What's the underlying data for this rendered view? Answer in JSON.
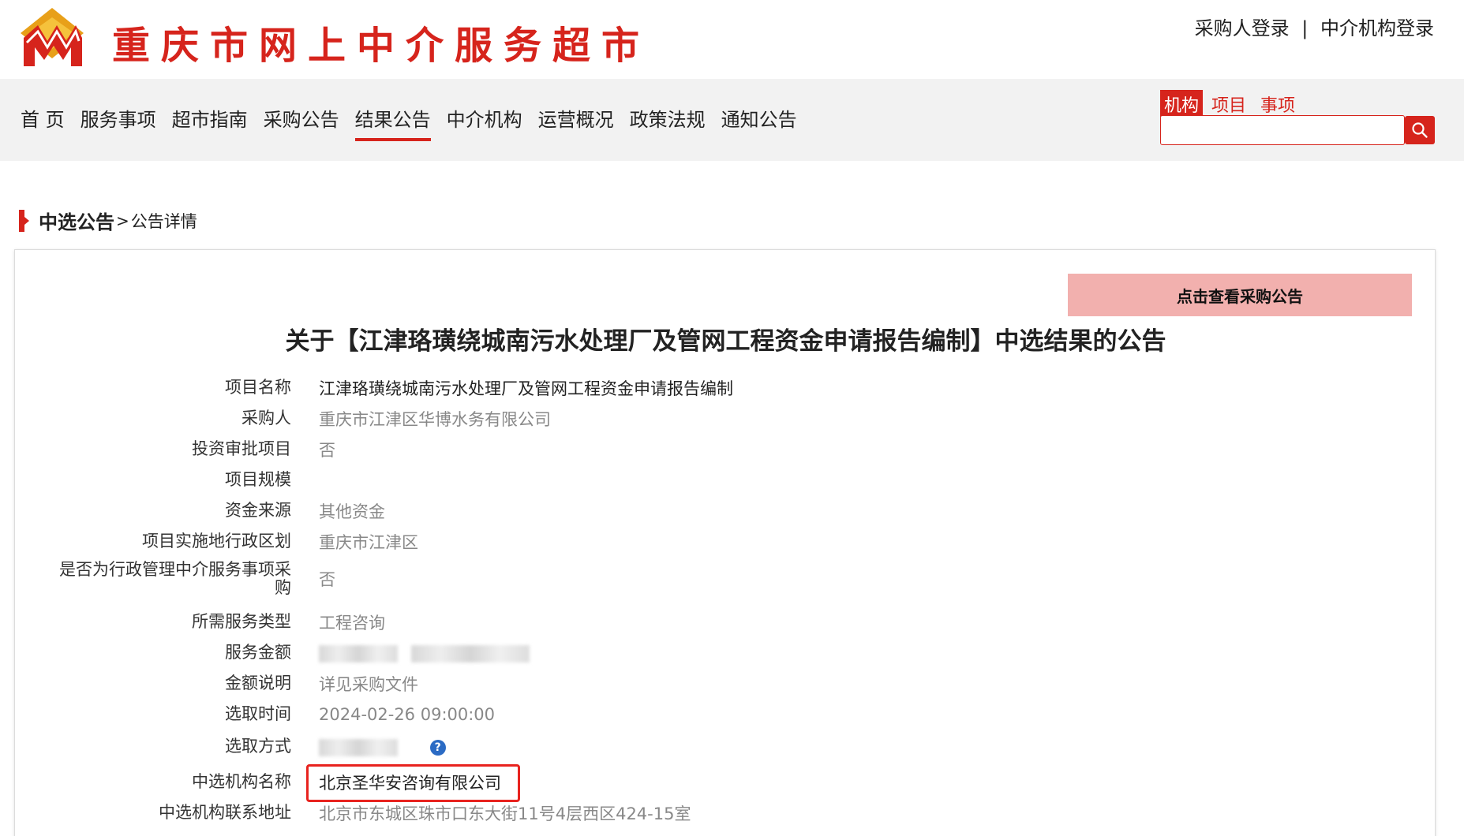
{
  "header": {
    "site_title": "重庆市网上中介服务超市",
    "buyer_login": "采购人登录",
    "separator": "|",
    "agency_login": "中介机构登录"
  },
  "nav": {
    "items": [
      "首 页",
      "服务事项",
      "超市指南",
      "采购公告",
      "结果公告",
      "中介机构",
      "运营概况",
      "政策法规",
      "通知公告"
    ],
    "active_index": 4
  },
  "search": {
    "tabs": [
      "机构",
      "项目",
      "事项"
    ],
    "active_tab": "机构",
    "value": "",
    "placeholder": ""
  },
  "breadcrumb": {
    "main": "中选公告",
    "separator": ">",
    "sub": "公告详情"
  },
  "notice": {
    "view_button": "点击查看采购公告",
    "title": "关于【江津珞璜绕城南污水处理厂及管网工程资金申请报告编制】中选结果的公告",
    "fields": [
      {
        "label": "项目名称",
        "value": "江津珞璜绕城南污水处理厂及管网工程资金申请报告编制"
      },
      {
        "label": "采购人",
        "value": "重庆市江津区华博水务有限公司"
      },
      {
        "label": "投资审批项目",
        "value": "否"
      },
      {
        "label": "项目规模",
        "value": ""
      },
      {
        "label": "资金来源",
        "value": "其他资金"
      },
      {
        "label": "项目实施地行政区划",
        "value": "重庆市江津区"
      },
      {
        "label": "是否为行政管理中介服务事项采购",
        "value": "否"
      },
      {
        "label": "所需服务类型",
        "value": "工程咨询"
      },
      {
        "label": "服务金额",
        "value": ""
      },
      {
        "label": "金额说明",
        "value": "详见采购文件"
      },
      {
        "label": "选取时间",
        "value": "2024-02-26 09:00:00"
      },
      {
        "label": "选取方式",
        "value": ""
      },
      {
        "label": "中选机构名称",
        "value": "北京圣华安咨询有限公司"
      },
      {
        "label": "中选机构联系地址",
        "value": "北京市东城区珠市口东大街11号4层西区424-15室"
      }
    ]
  },
  "colors": {
    "brand_red": "#d6241c",
    "highlight": "#e8231f",
    "button_pink": "#f2b0ae",
    "nav_bg": "#f2f2f2"
  },
  "icons": {
    "search_button": "search-icon",
    "help": "help-icon",
    "logo": "logo-icon"
  }
}
